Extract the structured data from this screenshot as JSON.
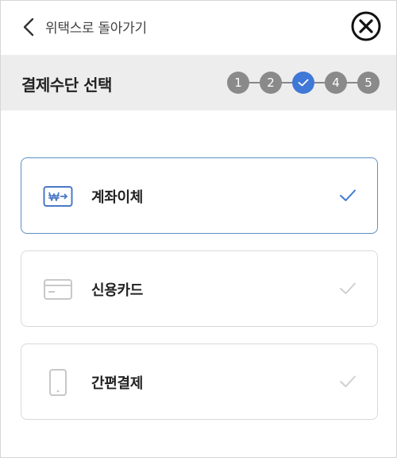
{
  "header": {
    "back_label": "위택스로 돌아가기"
  },
  "step_bar": {
    "title": "결제수단 선택",
    "steps": [
      "1",
      "2",
      "",
      "4",
      "5"
    ],
    "current_step": 3
  },
  "payment_methods": [
    {
      "label": "계좌이체",
      "icon": "won-transfer-icon",
      "selected": true
    },
    {
      "label": "신용카드",
      "icon": "credit-card-icon",
      "selected": false
    },
    {
      "label": "간편결제",
      "icon": "smartphone-icon",
      "selected": false
    }
  ],
  "colors": {
    "accent": "#3f78d6",
    "selected_border": "#5b8fc8",
    "step_inactive": "#8a8a8a",
    "step_bar_bg": "#ededed",
    "muted_check": "#d0d0d0"
  }
}
